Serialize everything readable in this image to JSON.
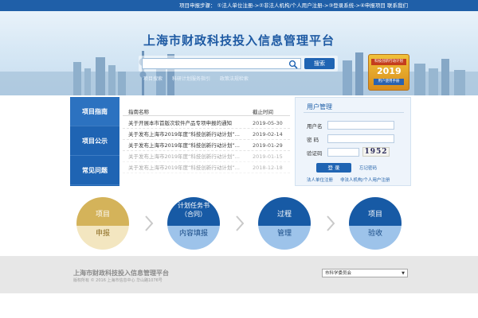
{
  "topbar": {
    "steps": "项目申报步骤：  ①法人单位注册->②非法人机构/个人用户注册->③登录系统->④申报项目  联系我们"
  },
  "hero": {
    "title": "上海市财政科技投入信息管理平台",
    "search": {
      "placeholder": "",
      "button": "搜索"
    },
    "quick_links": [
      "项目搜索",
      "科研计划服务指引",
      "政策法规检索"
    ],
    "manual_badge": {
      "top": "科技创新行动计划",
      "bottom": "用户使用手册",
      "year": "2019"
    }
  },
  "side_tabs": [
    "项目指南",
    "项目公示",
    "常见问题"
  ],
  "notice": {
    "col_name": "指南名称",
    "col_date": "截止时间",
    "rows": [
      {
        "title": "关于开展本市首版次软件产品专项申报的通知",
        "date": "2019-05-30"
      },
      {
        "title": "关于发布上海市2019年度“科技创新行动计划”...",
        "date": "2019-02-14"
      },
      {
        "title": "关于发布上海市2019年度“科技创新行动计划”...",
        "date": "2019-01-29"
      },
      {
        "title": "关于发布上海市2019年度“科技创新行动计划”...",
        "date": "2019-01-15"
      },
      {
        "title": "关于发布上海市2019年度“科技创新行动计划”...",
        "date": "2018-12-18"
      }
    ]
  },
  "login": {
    "title": "用户管理",
    "username_label": "用户名",
    "password_label": "密  码",
    "captcha_label": "验证码",
    "captcha_text": "1952",
    "login_button": "登  录",
    "forgot": "忘记密码",
    "reg_legal": "法人单位注册",
    "reg_personal": "非法人机构/个人用户注册"
  },
  "process": [
    {
      "top": "项目",
      "bottom": "申报"
    },
    {
      "top": "计划任务书\n（合同）",
      "bottom": "内容填报"
    },
    {
      "top": "过程",
      "bottom": "管理"
    },
    {
      "top": "项目",
      "bottom": "验收"
    }
  ],
  "footer": {
    "title": "上海市财政科技投入信息管理平台",
    "copyright": "版权所有 © 2016 上海市信息中心 华山路1076号",
    "select_value": "市科学委员会"
  },
  "colors": {
    "primary": "#1f64b3",
    "gold": "#d4b35a",
    "footer_bg": "#e7e7e7"
  }
}
